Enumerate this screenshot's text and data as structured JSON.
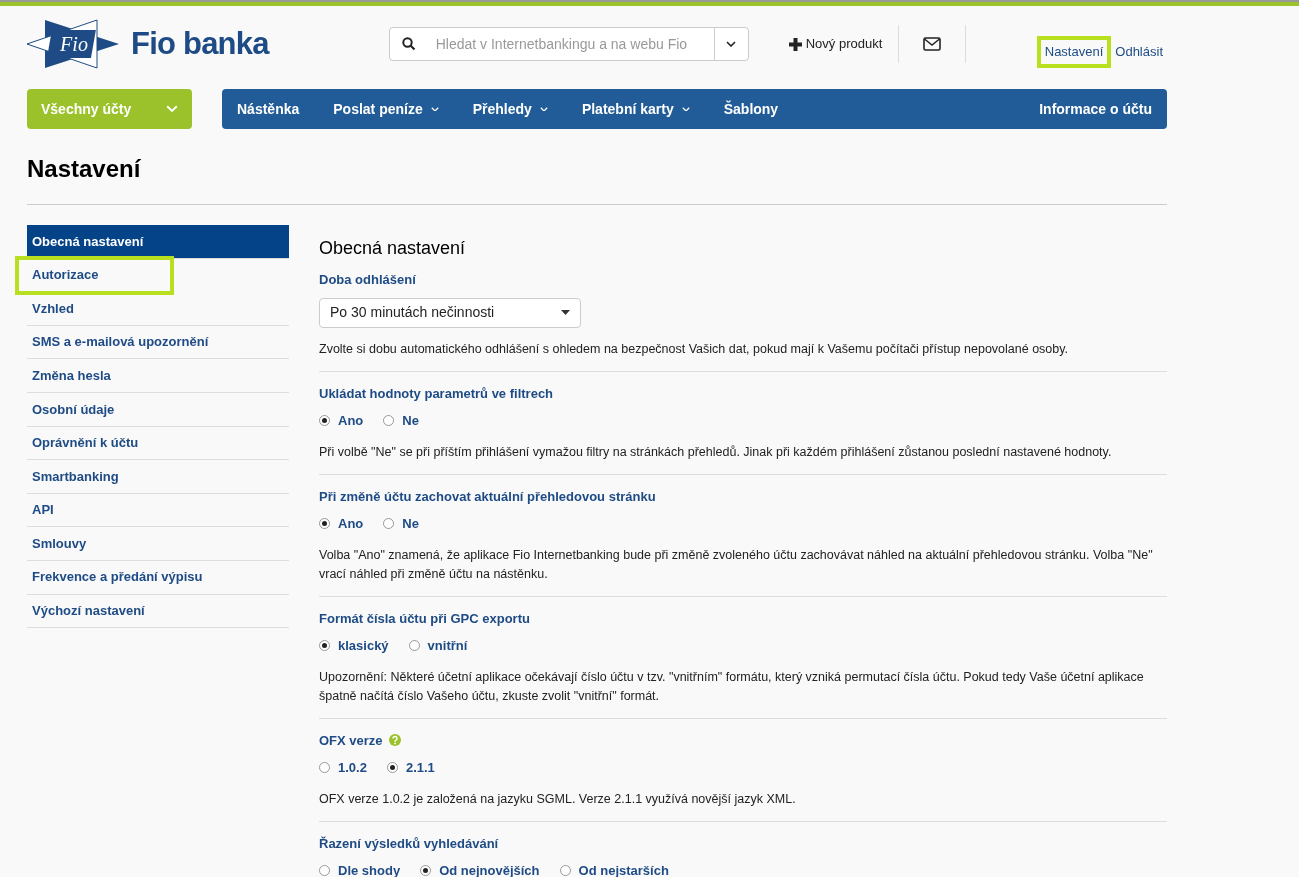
{
  "header": {
    "logo": {
      "mark": "Fio",
      "name": "Fio banka"
    },
    "search": {
      "placeholder": "Hledat v Internetbankingu a na webu Fio"
    },
    "new_product": "Nový produkt",
    "links": [
      {
        "label": "Nastavení",
        "highlighted": true
      },
      {
        "label": "Odhlásit",
        "highlighted": false
      }
    ]
  },
  "accounts_button": "Všechny účty",
  "nav": {
    "items": [
      {
        "label": "Nástěnka",
        "dropdown": false
      },
      {
        "label": "Poslat peníze",
        "dropdown": true
      },
      {
        "label": "Přehledy",
        "dropdown": true
      },
      {
        "label": "Platební karty",
        "dropdown": true
      },
      {
        "label": "Šablony",
        "dropdown": false
      }
    ],
    "right": "Informace o účtu"
  },
  "page_title": "Nastavení",
  "sidebar": {
    "items": [
      {
        "label": "Obecná nastavení",
        "selected": true,
        "highlighted": false
      },
      {
        "label": "Autorizace",
        "selected": false,
        "highlighted": true
      },
      {
        "label": "Vzhled",
        "selected": false,
        "highlighted": false
      },
      {
        "label": "SMS a e-mailová upozornění",
        "selected": false,
        "highlighted": false
      },
      {
        "label": "Změna hesla",
        "selected": false,
        "highlighted": false
      },
      {
        "label": "Osobní údaje",
        "selected": false,
        "highlighted": false
      },
      {
        "label": "Oprávnění k účtu",
        "selected": false,
        "highlighted": false
      },
      {
        "label": "Smartbanking",
        "selected": false,
        "highlighted": false
      },
      {
        "label": "API",
        "selected": false,
        "highlighted": false
      },
      {
        "label": "Smlouvy",
        "selected": false,
        "highlighted": false
      },
      {
        "label": "Frekvence a předání výpisu",
        "selected": false,
        "highlighted": false
      },
      {
        "label": "Výchozí nastavení",
        "selected": false,
        "highlighted": false
      }
    ]
  },
  "content": {
    "title": "Obecná nastavení",
    "sections": [
      {
        "kind": "select",
        "title": "Doba odhlášení",
        "help": false,
        "value": "Po 30 minutách nečinnosti",
        "description": "Zvolte si dobu automatického odhlášení s ohledem na bezpečnost Vašich dat, pokud mají k Vašemu počítači přístup nepovolané osoby."
      },
      {
        "kind": "radio",
        "title": "Ukládat hodnoty parametrů ve filtrech",
        "help": false,
        "options": [
          {
            "label": "Ano",
            "selected": true
          },
          {
            "label": "Ne",
            "selected": false
          }
        ],
        "description": "Při volbě \"Ne\" se při příštím přihlášení vymažou filtry na stránkách přehledů. Jinak při každém přihlášení zůstanou poslední nastavené hodnoty."
      },
      {
        "kind": "radio",
        "title": "Při změně účtu zachovat aktuální přehledovou stránku",
        "help": false,
        "options": [
          {
            "label": "Ano",
            "selected": true
          },
          {
            "label": "Ne",
            "selected": false
          }
        ],
        "description": "Volba \"Ano\" znamená, že aplikace Fio Internetbanking bude při změně zvoleného účtu zachovávat náhled na aktuální přehledovou stránku. Volba \"Ne\" vrací náhled při změně účtu na nástěnku."
      },
      {
        "kind": "radio",
        "title": "Formát čísla účtu při GPC exportu",
        "help": false,
        "options": [
          {
            "label": "klasický",
            "selected": true
          },
          {
            "label": "vnitřní",
            "selected": false
          }
        ],
        "description": "Upozornění: Některé účetní aplikace očekávají číslo účtu v tzv. \"vnitřním\" formátu, který vzniká permutací čísla účtu. Pokud tedy Vaše účetní aplikace špatně načítá číslo Vašeho účtu, zkuste zvolit \"vnitřní\" formát."
      },
      {
        "kind": "radio",
        "title": "OFX verze",
        "help": true,
        "options": [
          {
            "label": "1.0.2",
            "selected": false
          },
          {
            "label": "2.1.1",
            "selected": true
          }
        ],
        "description": "OFX verze 1.0.2 je založená na jazyku SGML. Verze 2.1.1 využívá novější jazyk XML."
      },
      {
        "kind": "radio",
        "title": "Řazení výsledků vyhledávání",
        "help": false,
        "options": [
          {
            "label": "Dle shody",
            "selected": false
          },
          {
            "label": "Od nejnovějších",
            "selected": true
          },
          {
            "label": "Od nejstarších",
            "selected": false
          }
        ]
      }
    ]
  }
}
